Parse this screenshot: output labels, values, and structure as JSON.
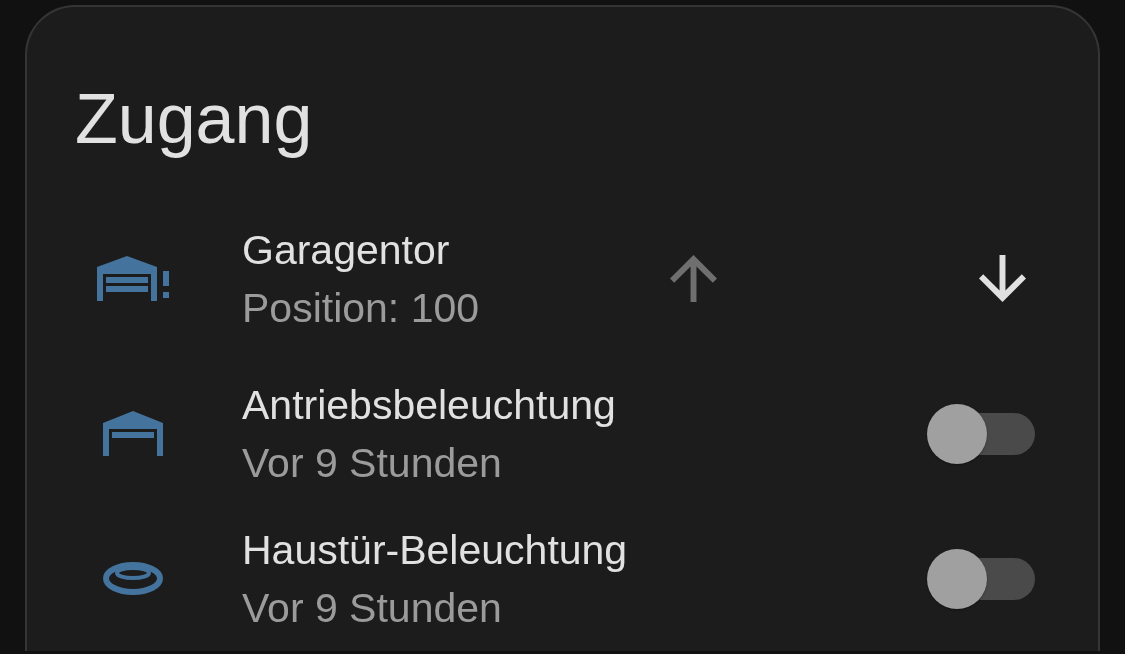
{
  "card": {
    "title": "Zugang",
    "rows": [
      {
        "kind": "cover",
        "name": "Garagentor",
        "secondary": "Position: 100",
        "buttons": [
          {
            "kind": "up",
            "disabled": true
          },
          {
            "kind": "down",
            "disabled": false
          }
        ]
      },
      {
        "kind": "switch",
        "name": "Antriebsbeleuchtung",
        "secondary": "Vor 9 Stunden",
        "on": false
      },
      {
        "kind": "switch",
        "name": "Haustür-Beleuchtung",
        "secondary": "Vor 9 Stunden",
        "on": false
      }
    ]
  }
}
